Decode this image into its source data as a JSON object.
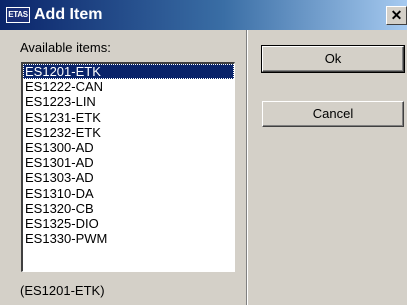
{
  "window": {
    "title": "Add Item",
    "app_icon_text": "ETAS",
    "close_glyph": "✕"
  },
  "list": {
    "label": "Available items:",
    "items": [
      "ES1201-ETK",
      "ES1222-CAN",
      "ES1223-LIN",
      "ES1231-ETK",
      "ES1232-ETK",
      "ES1300-AD",
      "ES1301-AD",
      "ES1303-AD",
      "ES1310-DA",
      "ES1320-CB",
      "ES1325-DIO",
      "ES1330-PWM"
    ],
    "selected_index": 0
  },
  "status": "(ES1201-ETK)",
  "buttons": {
    "ok": "Ok",
    "cancel": "Cancel"
  },
  "colors": {
    "selection": "#0a246a",
    "dialog_bg": "#d4d0c8"
  }
}
